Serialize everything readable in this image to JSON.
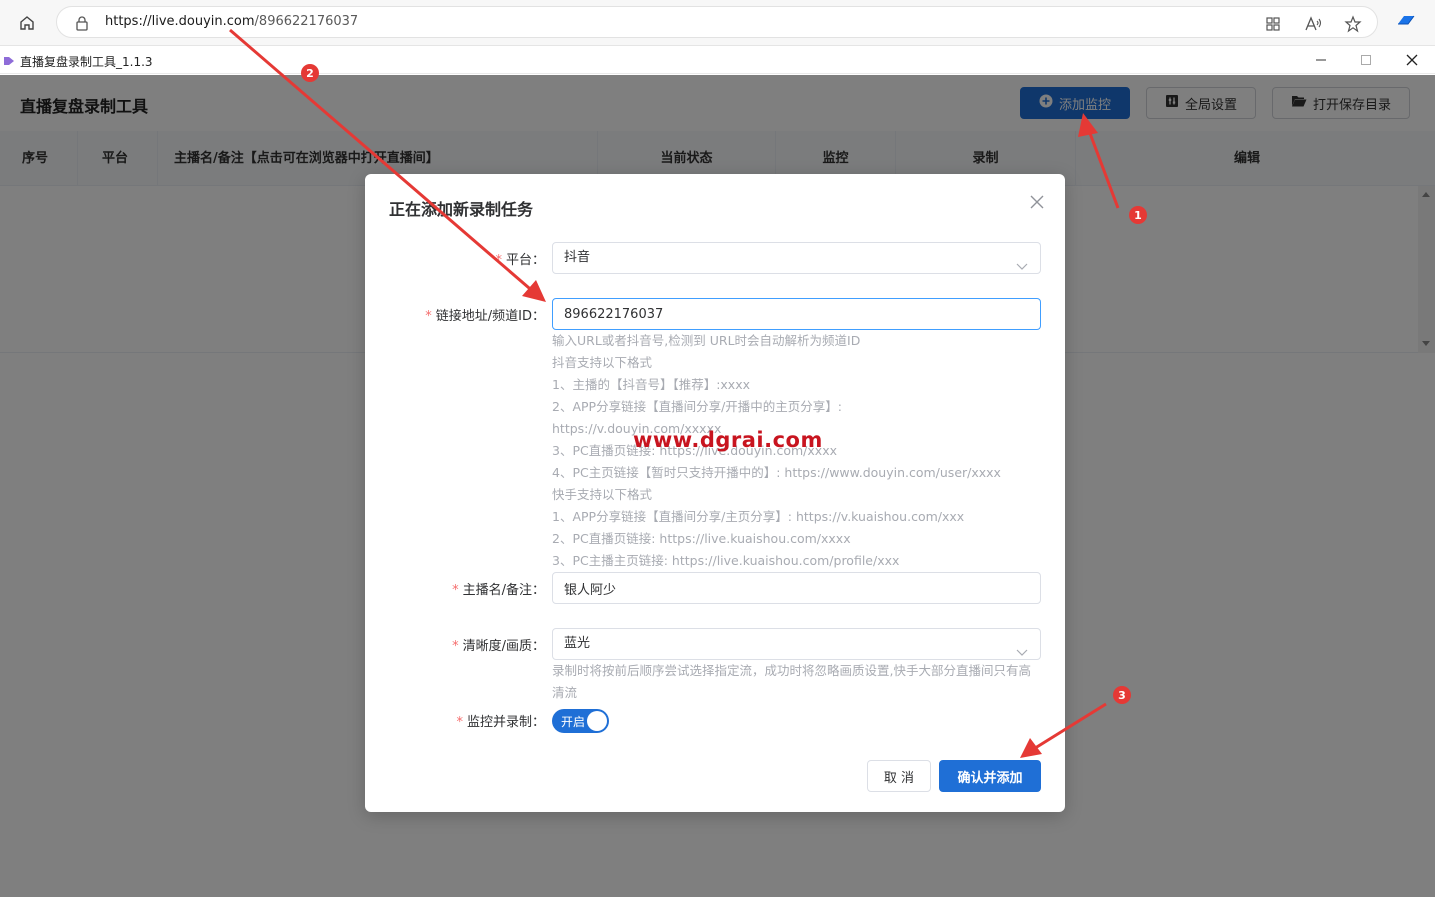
{
  "browser": {
    "url_scheme_and_host": "https://live.douyin.com",
    "url_path": "/896622176037"
  },
  "app": {
    "window_title": "直播复盘录制工具_1.1.3",
    "heading": "直播复盘录制工具",
    "buttons": {
      "add_monitor": "添加监控",
      "global_settings": "全局设置",
      "open_save_dir": "打开保存目录"
    }
  },
  "table": {
    "columns": [
      "序号",
      "平台",
      "主播名/备注【点击可在浏览器中打开直播间】",
      "当前状态",
      "监控",
      "录制",
      "编辑"
    ]
  },
  "dialog": {
    "title": "正在添加新录制任务",
    "platform": {
      "label": "平台",
      "value": "抖音"
    },
    "link": {
      "label": "链接地址/频道ID",
      "value": "896622176037",
      "hints": [
        "输入URL或者抖音号,检测到 URL时会自动解析为频道ID",
        "抖音支持以下格式",
        "1、主播的【抖音号】【推荐】:xxxx",
        "2、APP分享链接【直播间分享/开播中的主页分享】:",
        "https://v.douyin.com/xxxxx",
        "3、PC直播页链接: https://live.douyin.com/xxxx",
        "4、PC主页链接【暂时只支持开播中的】: https://www.douyin.com/user/xxxx",
        "快手支持以下格式",
        "1、APP分享链接【直播间分享/主页分享】: https://v.kuaishou.com/xxx",
        "2、PC直播页链接: https://live.kuaishou.com/xxxx",
        "3、PC主播主页链接: https://live.kuaishou.com/profile/xxx"
      ]
    },
    "name": {
      "label": "主播名/备注",
      "value": "银人阿少"
    },
    "quality": {
      "label": "清晰度/画质",
      "value": "蓝光",
      "hint": "录制时将按前后顺序尝试选择指定流，成功时将忽略画质设置,快手大部分直播间只有高清流"
    },
    "monitor_record": {
      "label": "监控并录制",
      "switch_text": "开启",
      "on": true
    },
    "buttons": {
      "cancel": "取 消",
      "confirm": "确认并添加"
    }
  },
  "watermark": "www.dgrai.com",
  "annotations": {
    "badges": [
      "1",
      "2",
      "3"
    ],
    "color": "#e53935"
  }
}
